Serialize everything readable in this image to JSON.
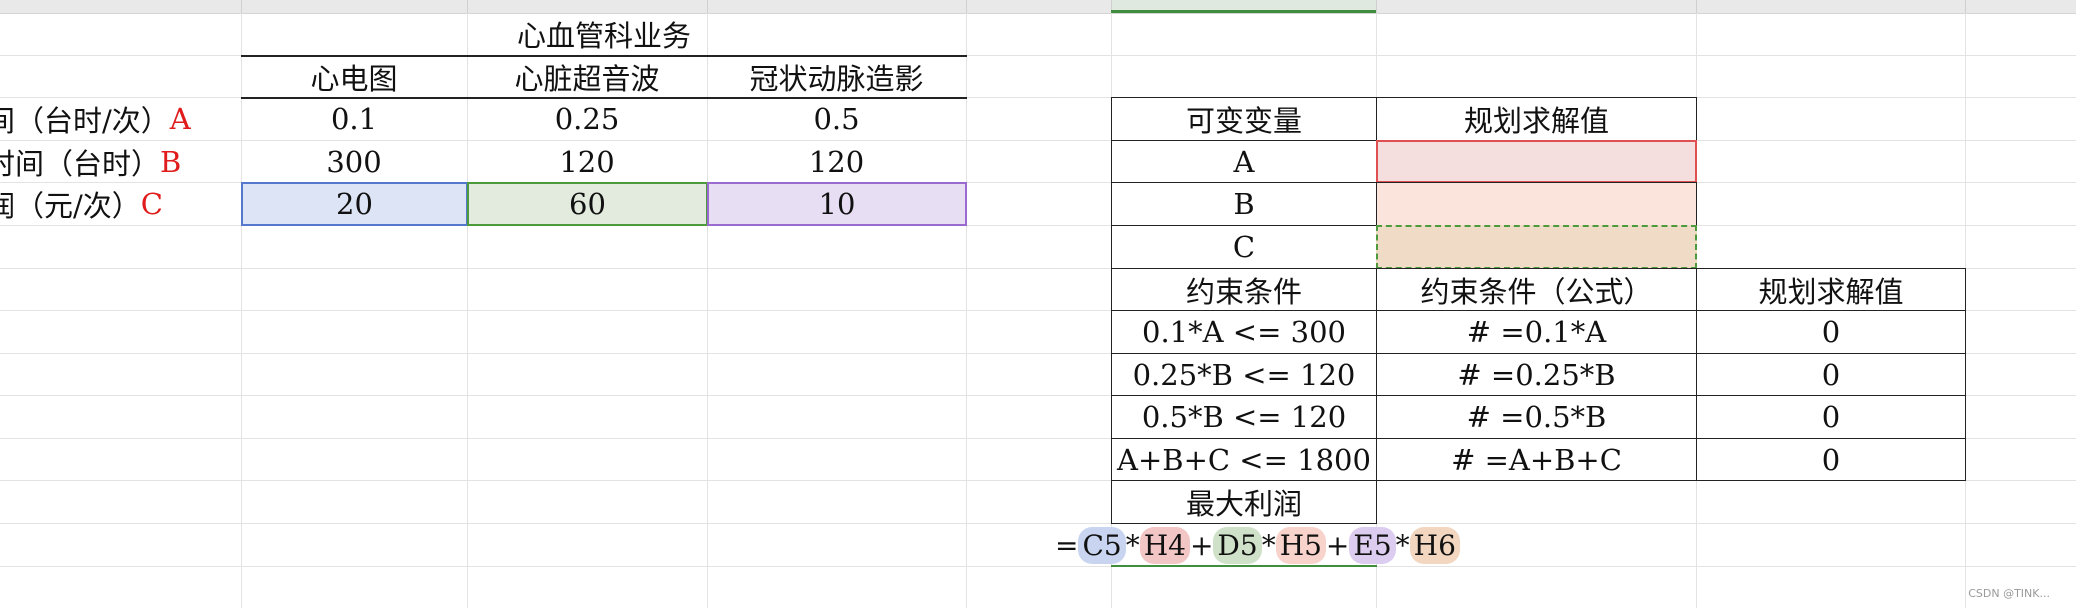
{
  "left_table": {
    "title": "心血管科业务",
    "headers": [
      "心电图",
      "心脏超音波",
      "冠状动脉造影"
    ],
    "rows": [
      {
        "label": "间（台时/次）",
        "var": "A",
        "values": [
          "0.1",
          "0.25",
          "0.5"
        ]
      },
      {
        "label": "时间（台时）",
        "var": "B",
        "values": [
          "300",
          "120",
          "120"
        ]
      },
      {
        "label": "润（元/次）",
        "var": "C",
        "values": [
          "20",
          "60",
          "10"
        ]
      }
    ]
  },
  "variables_table": {
    "headers": [
      "可变变量",
      "规划求解值"
    ],
    "rows": [
      {
        "name": "A",
        "value": ""
      },
      {
        "name": "B",
        "value": ""
      },
      {
        "name": "C",
        "value": ""
      }
    ]
  },
  "constraints_table": {
    "headers": [
      "约束条件",
      "约束条件（公式）",
      "规划求解值"
    ],
    "rows": [
      {
        "condition": "0.1*A <= 300",
        "formula": "# =0.1*A",
        "value": "0"
      },
      {
        "condition": "0.25*B <= 120",
        "formula": "# =0.25*B",
        "value": "0"
      },
      {
        "condition": "0.5*B <= 120",
        "formula": "# =0.5*B",
        "value": "0"
      },
      {
        "condition": "A+B+C <= 1800",
        "formula": "# =A+B+C",
        "value": "0"
      }
    ]
  },
  "max_profit": {
    "label": "最大利润",
    "formula_parts": [
      "=",
      "C5",
      "*",
      "H4",
      "+",
      "D5",
      "*",
      "H5",
      "+",
      "E5",
      "*",
      "H6"
    ]
  },
  "colors": {
    "ref_blue": "#c9d5f0",
    "ref_green": "#cfe2c9",
    "ref_purple": "#dccdf0",
    "ref_red": "#f3c6c6",
    "ref_pink": "#f7d3cc",
    "ref_orange": "#f2d6bf",
    "label_var": "#e01b1b"
  },
  "watermark": "CSDN @TINK..."
}
